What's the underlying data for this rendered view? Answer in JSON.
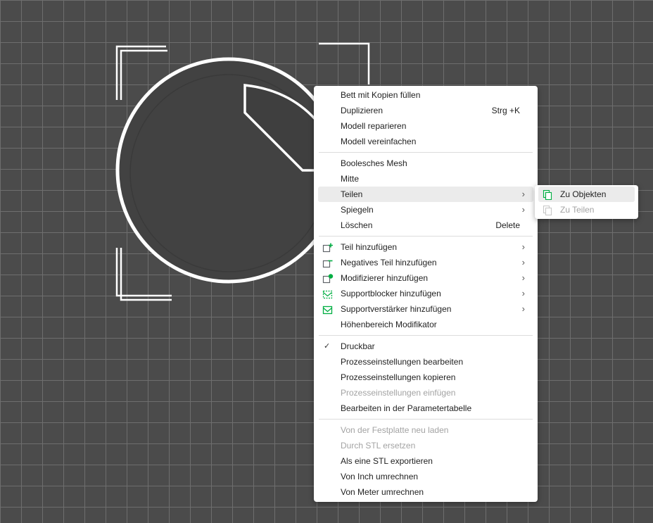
{
  "menu": {
    "groups": [
      [
        {
          "label": "Bett mit Kopien füllen"
        },
        {
          "label": "Duplizieren",
          "shortcut": "Strg +K"
        },
        {
          "label": "Modell reparieren"
        },
        {
          "label": "Modell vereinfachen"
        }
      ],
      [
        {
          "label": "Boolesches Mesh"
        },
        {
          "label": "Mitte"
        },
        {
          "label": "Teilen",
          "submenu": true,
          "highlighted": true
        },
        {
          "label": "Spiegeln",
          "submenu": true
        },
        {
          "label": "Löschen",
          "shortcut": "Delete"
        }
      ],
      [
        {
          "label": "Teil hinzufügen",
          "submenu": true,
          "icon": "add-part-icon"
        },
        {
          "label": "Negatives Teil hinzufügen",
          "submenu": true,
          "icon": "negative-part-icon"
        },
        {
          "label": "Modifizierer hinzufügen",
          "submenu": true,
          "icon": "modifier-icon"
        },
        {
          "label": "Supportblocker hinzufügen",
          "submenu": true,
          "icon": "support-blocker-icon"
        },
        {
          "label": "Supportverstärker hinzufügen",
          "submenu": true,
          "icon": "support-enforcer-icon"
        },
        {
          "label": "Höhenbereich Modifikator"
        }
      ],
      [
        {
          "label": "Druckbar",
          "checked": true
        },
        {
          "label": "Prozesseinstellungen bearbeiten"
        },
        {
          "label": "Prozesseinstellungen kopieren"
        },
        {
          "label": "Prozesseinstellungen einfügen",
          "disabled": true
        },
        {
          "label": "Bearbeiten in der Parametertabelle"
        }
      ],
      [
        {
          "label": "Von der Festplatte neu laden",
          "disabled": true
        },
        {
          "label": "Durch STL ersetzen",
          "disabled": true
        },
        {
          "label": "Als eine STL exportieren"
        },
        {
          "label": "Von Inch umrechnen"
        },
        {
          "label": "Von Meter umrechnen"
        }
      ]
    ]
  },
  "submenu": {
    "items": [
      {
        "label": "Zu Objekten",
        "highlighted": true,
        "icon": "split-objects-icon"
      },
      {
        "label": "Zu Teilen",
        "disabled": true,
        "icon": "split-parts-icon"
      }
    ]
  },
  "colors": {
    "accent": "#00ae42",
    "icon_line": "#5f6368",
    "grid_bg": "#4b4b4b",
    "grid_line": "#6e6e6e"
  }
}
